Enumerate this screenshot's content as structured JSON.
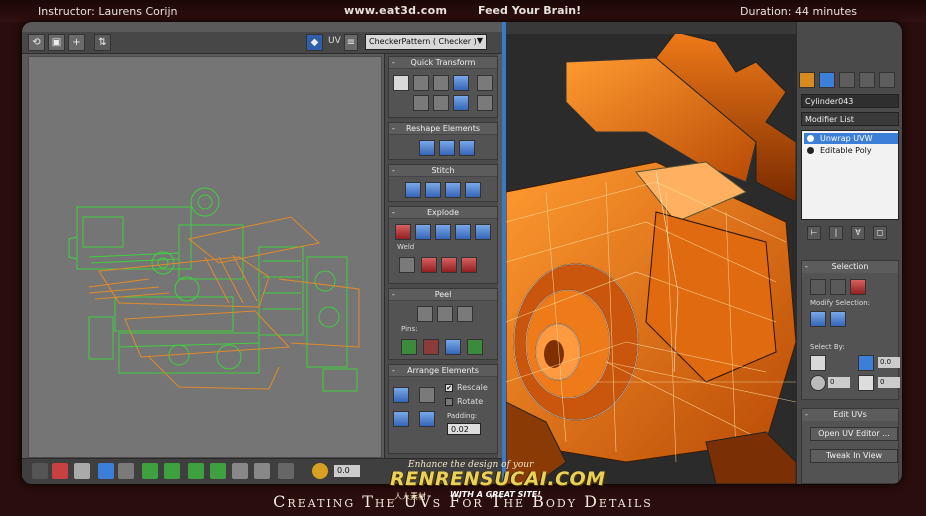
{
  "banner": {
    "instructor": "Instructor: Laurens Corijn",
    "site": "www.eat3d.com",
    "slogan": "Feed Your Brain!",
    "duration": "Duration: 44 minutes"
  },
  "uv_editor": {
    "uv_label": "UV",
    "checker_pattern": "CheckerPattern  ( Checker )",
    "rollouts": {
      "quick_transform": "Quick Transform",
      "reshape_elements": "Reshape Elements",
      "stitch": "Stitch",
      "explode": "Explode",
      "weld": "Weld",
      "peel": "Peel",
      "pins": "Pins:",
      "arrange_elements": "Arrange Elements",
      "rescale": "Rescale",
      "rotate": "Rotate",
      "padding_label": "Padding:",
      "padding_value": "0.02"
    },
    "bottom_value": "0.0"
  },
  "command_panel": {
    "object_name": "Cylinder043",
    "modifier_list": "Modifier List",
    "stack": [
      "Unwrap UVW",
      "Editable Poly"
    ],
    "selected_stack_index": 0,
    "selection_title": "Selection",
    "modify_selection": "Modify Selection:",
    "select_by": "Select By:",
    "spinner_values": [
      "0.0",
      "0",
      "0"
    ],
    "edit_uvs_title": "Edit UVs",
    "open_uv_editor": "Open UV Editor ...",
    "tweak_in_view": "Tweak In View"
  },
  "bottom_title": "Creating The UVs For The Body Details",
  "watermark": {
    "top": "Enhance the design of your",
    "main": "RENRENSUCAI.COM",
    "sub_cn": "人人素材",
    "sub_en": "WITH A GREAT SITE!"
  },
  "colors": {
    "accent_blue": "#3b7fd8",
    "uv_green": "#40c040",
    "uv_orange": "#e08020",
    "mesh_orange": "#d86a10"
  },
  "icons": [
    "undo-icon",
    "frame-icon",
    "checker-icon",
    "quick-transform-icons",
    "stitch-icons",
    "explode-icons",
    "peel-icons",
    "pin-icons"
  ]
}
